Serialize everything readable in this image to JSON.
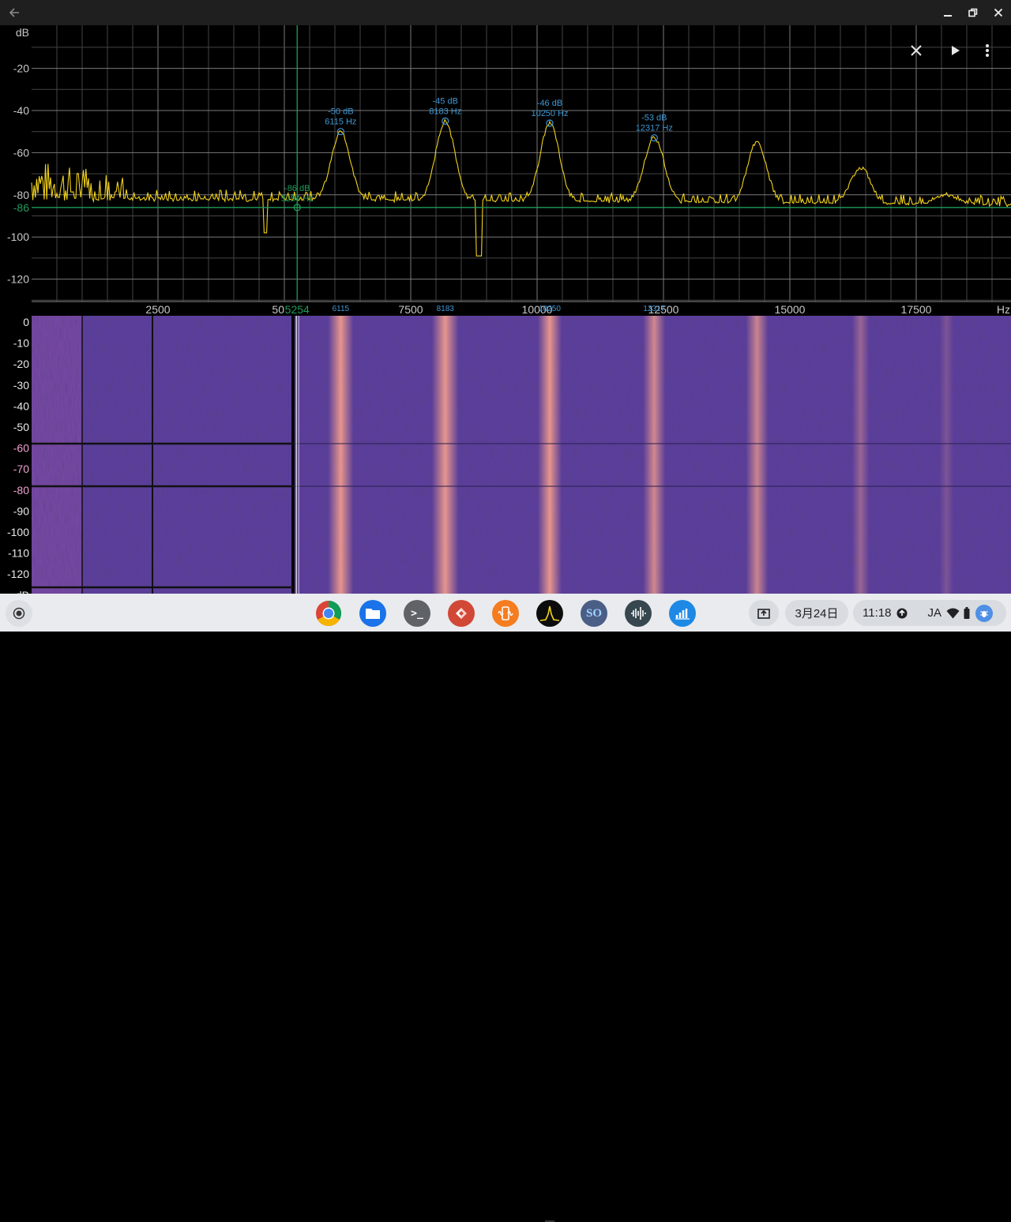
{
  "spectrum": {
    "y_unit": "dB",
    "y_ticks": [
      "-20",
      "-40",
      "-60",
      "-80",
      "-100",
      "-120"
    ],
    "x_unit": "Hz",
    "x_ticks": [
      "2500",
      "5000",
      "7500",
      "10000",
      "12500",
      "15000",
      "17500"
    ],
    "cursor": {
      "db_label": "-86",
      "freq_label": "5254",
      "readout_db": "-86 dB",
      "readout_hz": "5254 Hz",
      "db": -86,
      "freq": 5254
    },
    "peaks": [
      {
        "db_label": "-50 dB",
        "hz_label": "6115 Hz",
        "axis_label": "6115",
        "db": -50,
        "freq": 6115
      },
      {
        "db_label": "-45 dB",
        "hz_label": "8183 Hz",
        "axis_label": "8183",
        "db": -45,
        "freq": 8183
      },
      {
        "db_label": "-46 dB",
        "hz_label": "10250 Hz",
        "axis_label": "10250",
        "db": -46,
        "freq": 10250
      },
      {
        "db_label": "-53 dB",
        "hz_label": "12317 Hz",
        "axis_label": "12317",
        "db": -53,
        "freq": 12317
      }
    ],
    "colors": {
      "trace": "#f2d21a",
      "grid": "#5a5a5a",
      "axis_text": "#c8c8c8",
      "cursor": "#1e9c5a",
      "peak": "#3f97d4"
    }
  },
  "spectrogram": {
    "y_ticks": [
      "0",
      "-10",
      "-20",
      "-30",
      "-40",
      "-50",
      "-60",
      "-70",
      "-80",
      "-90",
      "-100",
      "-110",
      "-120",
      "dB"
    ],
    "colors": {
      "background": "#5a3e9c",
      "band": "#ee9a8c"
    }
  },
  "toolbar": {
    "close_icon": "close-icon",
    "play_icon": "play-icon",
    "menu_icon": "more-vert-icon"
  },
  "titlebar": {
    "back_icon": "arrow-back-icon"
  },
  "shelf": {
    "apps": [
      "Chrome",
      "Files",
      "Terminal",
      "Remote Desktop",
      "Phyphox",
      "Spectroid",
      "Sound Oscilloscope",
      "Audio Recorder",
      "Data Logger"
    ],
    "date": "3月24日",
    "time": "11:18",
    "ime": "JA"
  }
}
